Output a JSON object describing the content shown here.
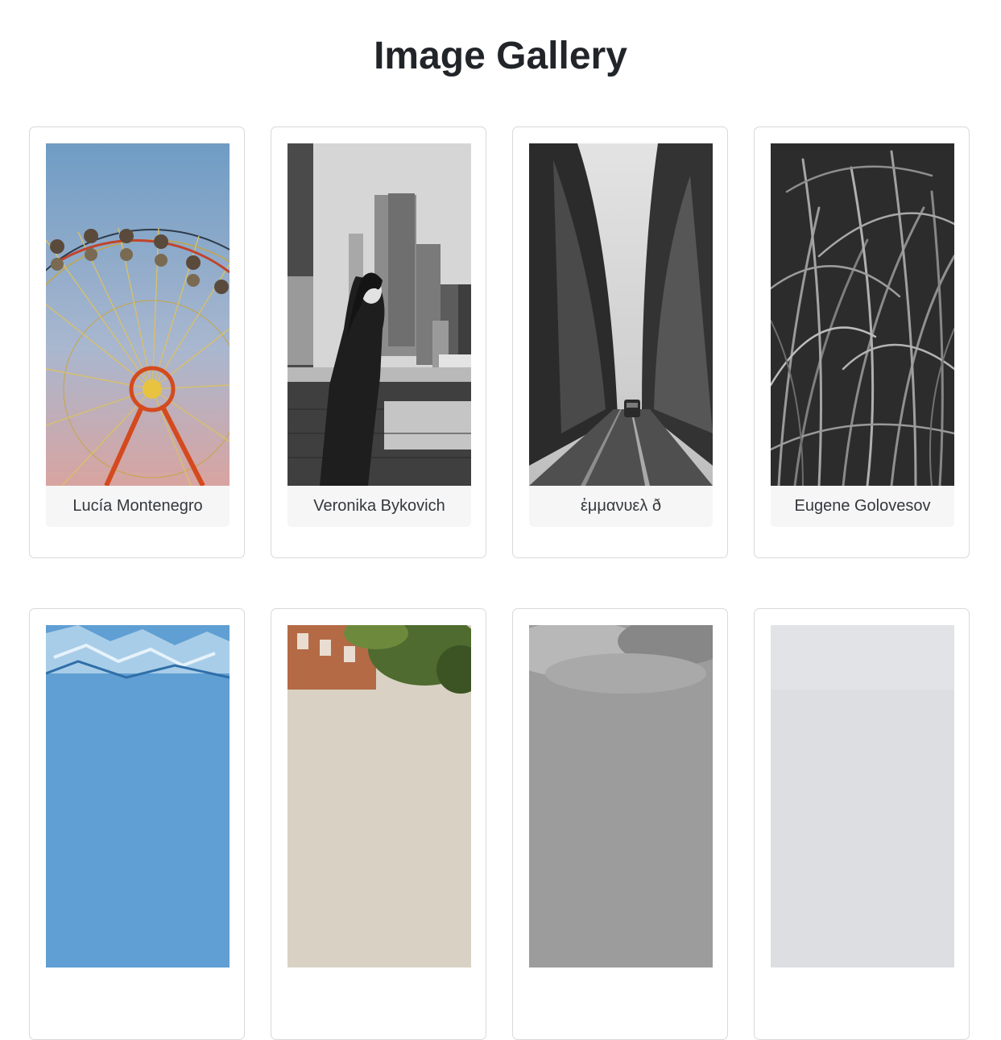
{
  "page": {
    "title": "Image Gallery"
  },
  "gallery": {
    "items": [
      {
        "photographer": "Lucía Montenegro",
        "image": "ferris-wheel"
      },
      {
        "photographer": "Veronika Bykovich",
        "image": "woman-city-skyline"
      },
      {
        "photographer": "ἐμμανυελ ð",
        "image": "foggy-forest-road"
      },
      {
        "photographer": "Eugene Golovesov",
        "image": "grass-blades"
      },
      {
        "photographer": "",
        "image": "blue-ice-texture"
      },
      {
        "photographer": "",
        "image": "tree-lined-street"
      },
      {
        "photographer": "",
        "image": "cloudy-sky"
      },
      {
        "photographer": "",
        "image": "pale-gray"
      }
    ]
  },
  "colors": {
    "title_text": "#212529",
    "card_border": "#d7d9dc",
    "caption_background": "#f6f6f7"
  }
}
